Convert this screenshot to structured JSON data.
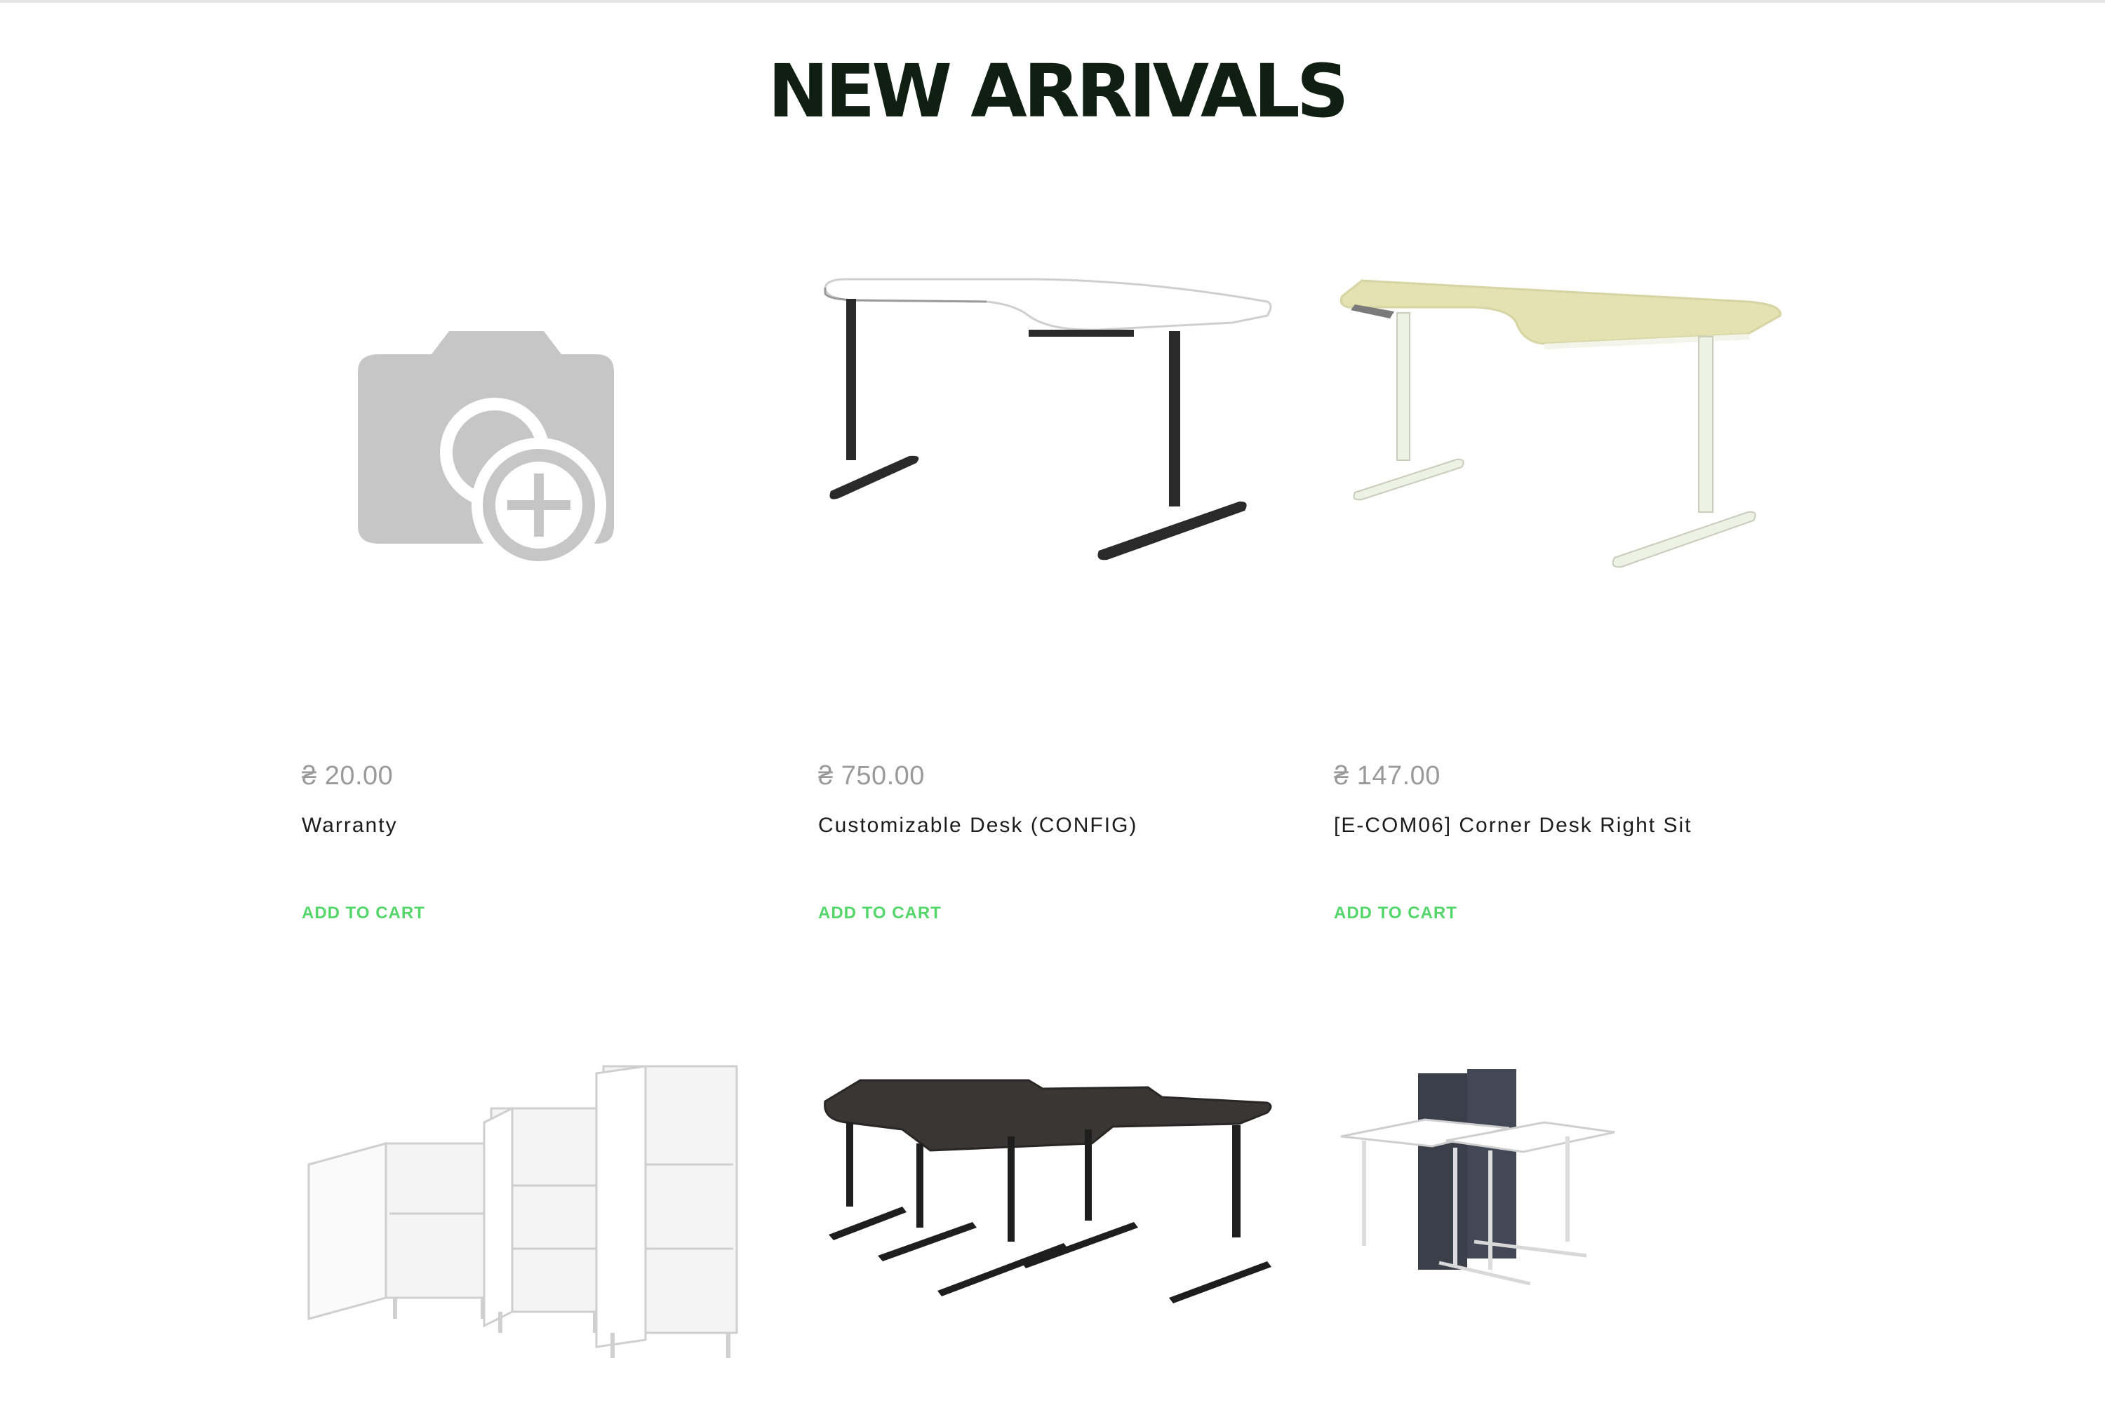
{
  "section": {
    "title": "NEW ARRIVALS"
  },
  "products": [
    {
      "price": "₴ 20.00",
      "name": "Warranty",
      "cta": "ADD TO CART",
      "image": "placeholder-camera-icon"
    },
    {
      "price": "₴ 750.00",
      "name": "Customizable Desk (CONFIG)",
      "cta": "ADD TO CART",
      "image": "corner-desk-white-black-legs"
    },
    {
      "price": "₴ 147.00",
      "name": "[E-COM06] Corner Desk Right Sit",
      "cta": "ADD TO CART",
      "image": "corner-desk-birch-white-legs"
    },
    {
      "image": "storage-cabinets-white"
    },
    {
      "image": "dual-desk-black"
    },
    {
      "image": "desks-with-screen-divider"
    }
  ],
  "colors": {
    "title": "#0f1f12",
    "price": "#9a9a9a",
    "name": "#1c1c1c",
    "cta": "#55d66b"
  }
}
